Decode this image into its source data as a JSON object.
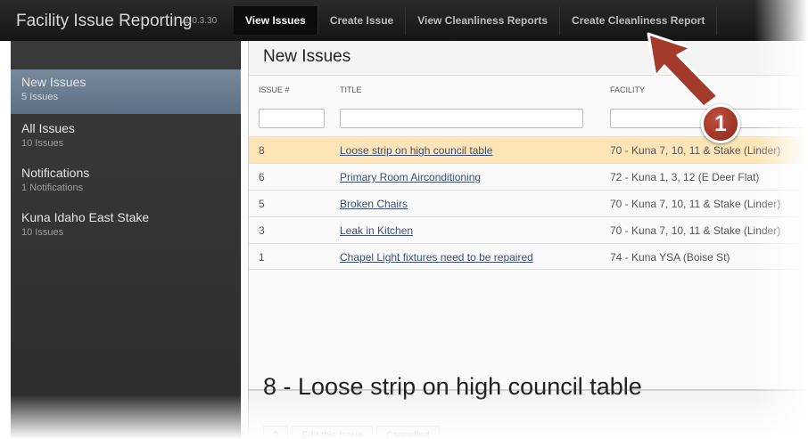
{
  "app": {
    "title": "Facility Issue Reporting",
    "version": "v1.0.3.30"
  },
  "nav": {
    "tabs": [
      {
        "label": "View Issues"
      },
      {
        "label": "Create Issue"
      },
      {
        "label": "View Cleanliness Reports"
      },
      {
        "label": "Create Cleanliness Report"
      }
    ]
  },
  "sidebar": {
    "items": [
      {
        "label": "New Issues",
        "count": "5 Issues"
      },
      {
        "label": "All Issues",
        "count": "10 Issues"
      },
      {
        "label": "Notifications",
        "count": "1 Notifications"
      },
      {
        "label": "Kuna Idaho East Stake",
        "count": "10 Issues"
      }
    ]
  },
  "list": {
    "title": "New Issues",
    "columns": {
      "issue": "ISSUE #",
      "title": "TITLE",
      "facility": "FACILITY"
    },
    "rows": [
      {
        "num": "8",
        "title": "Loose strip on high council table",
        "facility": "70 - Kuna 7, 10, 11 & Stake (Linder)"
      },
      {
        "num": "6",
        "title": "Primary Room Airconditioning",
        "facility": "72 - Kuna 1, 3, 12 (E Deer Flat)"
      },
      {
        "num": "5",
        "title": "Broken Chairs",
        "facility": "70 - Kuna 7, 10, 11 & Stake (Linder)"
      },
      {
        "num": "3",
        "title": "Leak in Kitchen",
        "facility": "70 - Kuna 7, 10, 11 & Stake (Linder)"
      },
      {
        "num": "1",
        "title": "Chapel Light fixtures need to be repaired",
        "facility": "74 - Kuna YSA (Boise St)"
      }
    ]
  },
  "detail": {
    "title": "8 - Loose strip on high council table",
    "toolbar": {
      "edit": "Edit this Issue",
      "cancel": "Cancelled"
    }
  },
  "annotation": {
    "badge": "1"
  },
  "colors": {
    "accent_selected_row": "#fde5b8",
    "sidebar_active": "#6b7d92",
    "annotation": "#a33a2a"
  }
}
